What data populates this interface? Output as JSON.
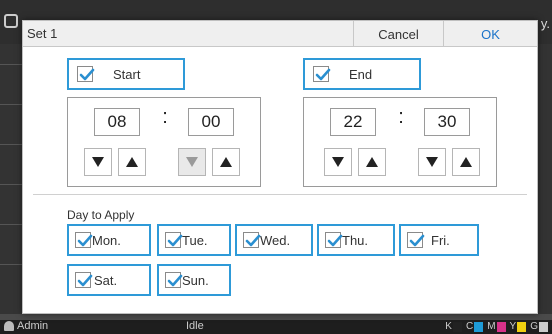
{
  "background": {
    "user_label": "Admin",
    "status_label": "Idle",
    "inks": [
      {
        "letter": "K",
        "color": "#222222"
      },
      {
        "letter": "C",
        "color": "#1e9bd7"
      },
      {
        "letter": "M",
        "color": "#d9328a"
      },
      {
        "letter": "Y",
        "color": "#f0d010"
      },
      {
        "letter": "G",
        "color": "#cccccc"
      }
    ],
    "edge_glyph": "y."
  },
  "dialog": {
    "title": "Set 1",
    "cancel_label": "Cancel",
    "ok_label": "OK",
    "start": {
      "label": "Start",
      "checked": true,
      "hour": "08",
      "minute": "00",
      "separator": ":",
      "minute_down_disabled": true
    },
    "end": {
      "label": "End",
      "checked": true,
      "hour": "22",
      "minute": "30",
      "separator": ":"
    },
    "day_heading": "Day to Apply",
    "days": [
      {
        "label": "Mon.",
        "checked": true
      },
      {
        "label": "Tue.",
        "checked": true
      },
      {
        "label": "Wed.",
        "checked": true
      },
      {
        "label": "Thu.",
        "checked": true
      },
      {
        "label": "Fri.",
        "checked": true
      },
      {
        "label": "Sat.",
        "checked": true
      },
      {
        "label": "Sun.",
        "checked": true
      }
    ]
  },
  "colors": {
    "accent": "#2e9ad8",
    "check": "#2a8fd0",
    "ok_text": "#1a73c9"
  }
}
